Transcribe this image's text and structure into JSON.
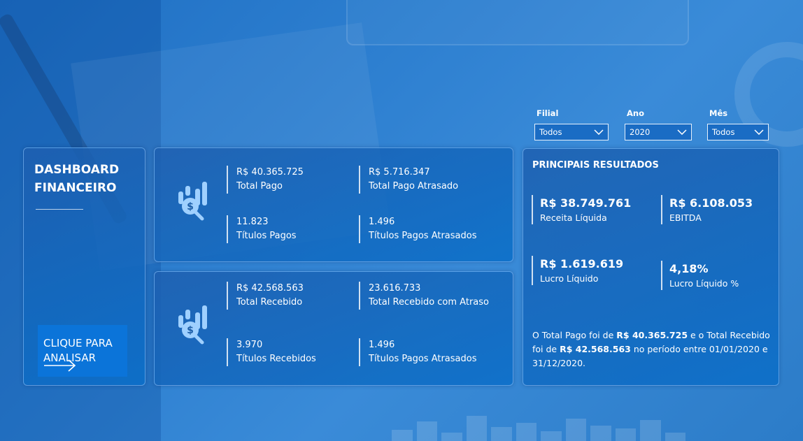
{
  "colors": {
    "accent": "#0b74d9",
    "background": "#2d7fd0",
    "card_border": "#96c8ff"
  },
  "filters": {
    "filial": {
      "label": "Filial",
      "value": "Todos"
    },
    "ano": {
      "label": "Ano",
      "value": "2020"
    },
    "mes": {
      "label": "Mês",
      "value": "Todos"
    }
  },
  "left_panel": {
    "title_line1": "DASHBOARD",
    "title_line2": "FINANCEIRO",
    "cta_line1": "CLIQUE PARA",
    "cta_line2": "ANALISAR",
    "cta_icon": "arrow-right-icon"
  },
  "kpi_paid": {
    "icon": "money-search-chart-icon",
    "total_pago_value": "R$ 40.365.725",
    "total_pago_label": "Total Pago",
    "total_pago_atrasado_value": "R$ 5.716.347",
    "total_pago_atrasado_label": "Total Pago Atrasado",
    "titulos_pagos_value": "11.823",
    "titulos_pagos_label": "Títulos Pagos",
    "titulos_pagos_atrasados_value": "1.496",
    "titulos_pagos_atrasados_label": "Títulos Pagos Atrasados"
  },
  "kpi_received": {
    "icon": "money-search-chart-icon",
    "total_recebido_value": "R$ 42.568.563",
    "total_recebido_label": "Total Recebido",
    "total_recebido_atraso_value": "23.616.733",
    "total_recebido_atraso_label": "Total Recebido com Atraso",
    "titulos_recebidos_value": "3.970",
    "titulos_recebidos_label": "Títulos Recebidos",
    "titulos_pagos_atrasados_value": "1.496",
    "titulos_pagos_atrasados_label": "Títulos Pagos Atrasados"
  },
  "results": {
    "header": "PRINCIPAIS RESULTADOS",
    "receita_value": "R$ 38.749.761",
    "receita_label": "Receita Líquida",
    "ebitda_value": "R$ 6.108.053",
    "ebitda_label": "EBITDA",
    "lucro_value": "R$ 1.619.619",
    "lucro_label": "Lucro Líquido",
    "lucro_pct_value": "4,18%",
    "lucro_pct_label": "Lucro Líquido %",
    "summary_p1": "O Total Pago foi de ",
    "summary_b1": "R$ 40.365.725",
    "summary_p2": " e o Total Recebido foi de ",
    "summary_b2": "R$ 42.568.563",
    "summary_p3": " no período entre 01/01/2020 e 31/12/2020."
  }
}
